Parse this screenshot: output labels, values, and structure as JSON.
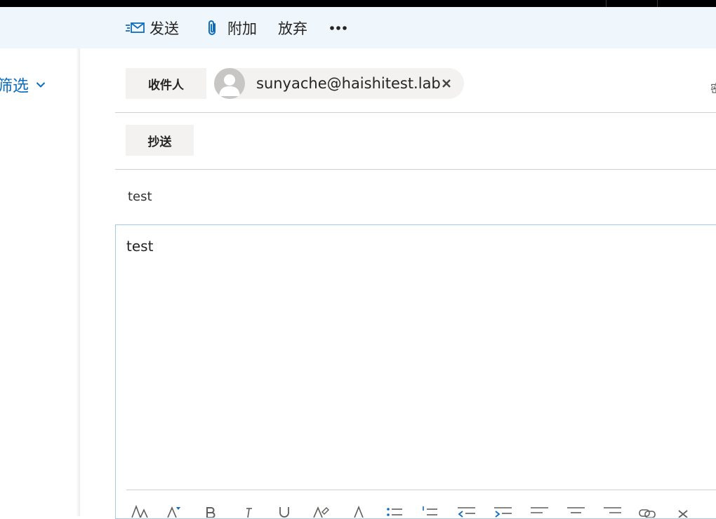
{
  "toolbar": {
    "send_label": "发送",
    "attach_label": "附加",
    "discard_label": "放弃",
    "more_icon": "more-horizontal-icon"
  },
  "left_pane": {
    "filter_label": "筛选"
  },
  "compose": {
    "to_button_label": "收件人",
    "cc_button_label": "抄送",
    "recipient_email": "sunyache@haishitest.lab",
    "right_cut_text": "密",
    "subject_value": "test",
    "body_text": "test"
  },
  "colors": {
    "accent": "#0f6cbd",
    "command_bar_bg": "#eff6fc",
    "button_bg": "#f3f2f1",
    "focus_border": "#a6c8e8"
  }
}
